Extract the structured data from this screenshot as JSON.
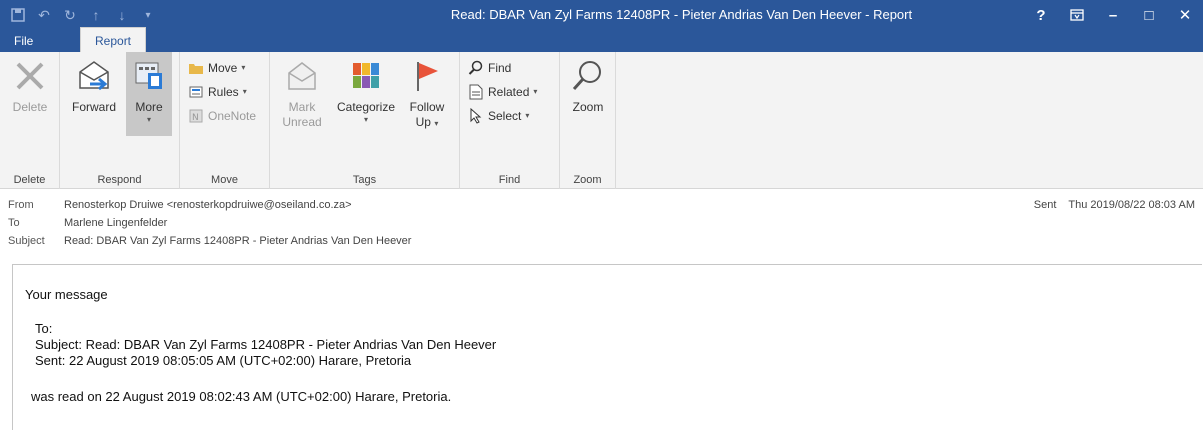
{
  "window": {
    "title": "Read: DBAR Van Zyl Farms 12408PR - Pieter Andrias Van Den Heever - Report",
    "accent": "#2b579a",
    "controls": [
      "?",
      "⧈",
      "–",
      "□",
      "✕"
    ]
  },
  "qat": [
    "save-icon",
    "undo-icon",
    "redo-icon",
    "up-icon",
    "down-icon",
    "customize-icon"
  ],
  "tabs": {
    "file": "File",
    "report": "Report"
  },
  "ribbon": {
    "delete": {
      "label": "Delete",
      "group": "Delete"
    },
    "respond": {
      "forward": "Forward",
      "more": "More",
      "group": "Respond"
    },
    "move": {
      "move": "Move",
      "rules": "Rules",
      "onenote": "OneNote",
      "group": "Move"
    },
    "tags": {
      "mark_unread_1": "Mark",
      "mark_unread_2": "Unread",
      "categorize": "Categorize",
      "follow_1": "Follow",
      "follow_2": "Up",
      "group": "Tags"
    },
    "find": {
      "find": "Find",
      "related": "Related",
      "select": "Select",
      "group": "Find"
    },
    "zoom": {
      "zoom": "Zoom",
      "group": "Zoom"
    }
  },
  "header": {
    "from_label": "From",
    "from": "Renosterkop Druiwe <renosterkopdruiwe@oseiland.co.za>",
    "to_label": "To",
    "to": "Marlene Lingenfelder",
    "subject_label": "Subject",
    "subject": "Read: DBAR Van Zyl Farms 12408PR - Pieter Andrias Van Den Heever",
    "sent_label": "Sent",
    "sent": "Thu 2019/08/22 08:03 AM"
  },
  "body": {
    "line1": "Your message",
    "to": "To:",
    "subject": "Subject: Read: DBAR Van Zyl Farms 12408PR - Pieter Andrias Van Den Heever",
    "sent": "Sent: 22 August 2019 08:05:05 AM (UTC+02:00) Harare, Pretoria",
    "read": "was read on 22 August 2019 08:02:43 AM (UTC+02:00) Harare, Pretoria."
  }
}
